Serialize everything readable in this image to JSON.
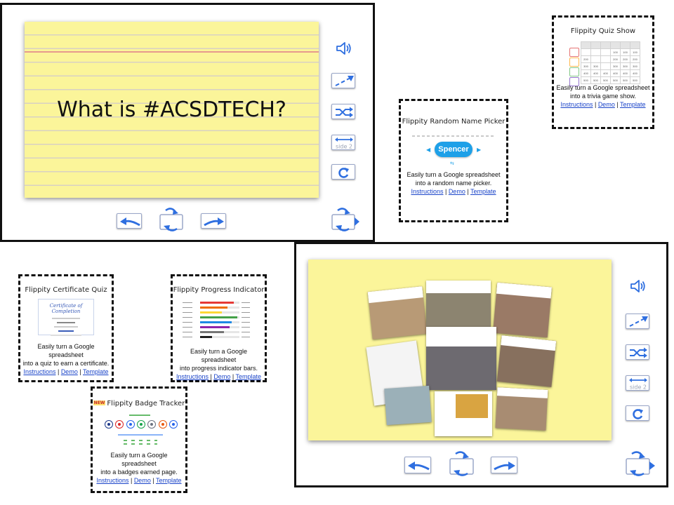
{
  "main_slide": {
    "card_text": "What is #ACSDTECH?"
  },
  "random_picker": {
    "title": "Flippity Random Name Picker",
    "selected_name": "Spencer",
    "desc_line1": "Easily turn a Google spreadsheet",
    "desc_line2": "into a random name picker.",
    "link_instructions": "Instructions",
    "link_demo": "Demo",
    "link_template": "Template",
    "sep": " | "
  },
  "quiz_show": {
    "title": "Flippity Quiz Show",
    "desc_line1": "Easily turn a Google spreadsheet",
    "desc_line2": "into a trivia game show.",
    "link_instructions": "Instructions",
    "link_demo": "Demo",
    "link_template": "Template",
    "sep": " | ",
    "rows": [
      [
        "",
        "",
        "",
        "100",
        "100",
        "100"
      ],
      [
        "200",
        "",
        "",
        "200",
        "200",
        "200"
      ],
      [
        "300",
        "300",
        "",
        "300",
        "300",
        "300"
      ],
      [
        "400",
        "400",
        "400",
        "400",
        "400",
        "400"
      ],
      [
        "500",
        "500",
        "500",
        "500",
        "500",
        "500"
      ]
    ]
  },
  "certificate_quiz": {
    "title": "Flippity Certificate Quiz",
    "cert_heading": "Certificate of Completion",
    "desc_line1": "Easily turn a Google spreadsheet",
    "desc_line2": "into a quiz to earn a certificate.",
    "link_instructions": "Instructions",
    "link_demo": "Demo",
    "link_template": "Template",
    "sep": " | "
  },
  "progress_indicator": {
    "title": "Flippity Progress Indicator",
    "desc_line1": "Easily turn a Google spreadsheet",
    "desc_line2": "into progress indicator bars.",
    "link_instructions": "Instructions",
    "link_demo": "Demo",
    "link_template": "Template",
    "sep": " | ",
    "bars": [
      {
        "fill": 0.85,
        "color": "#e53935"
      },
      {
        "fill": 0.7,
        "color": "#ef6c00"
      },
      {
        "fill": 0.55,
        "color": "#fdd835"
      },
      {
        "fill": 0.95,
        "color": "#43a047"
      },
      {
        "fill": 0.8,
        "color": "#1e88e5"
      },
      {
        "fill": 0.75,
        "color": "#8e24aa"
      },
      {
        "fill": 0.6,
        "color": "#757575"
      },
      {
        "fill": 0.3,
        "color": "#212121"
      }
    ]
  },
  "badge_tracker": {
    "new_badge": "NEW",
    "title": "Flippity Badge Tracker",
    "desc_line1": "Easily turn a Google spreadsheet",
    "desc_line2": "into a badges earned page.",
    "link_instructions": "Instructions",
    "link_demo": "Demo",
    "link_template": "Template",
    "sep": " | ",
    "badge_colors": [
      "#1e3a8a",
      "#dc2626",
      "#2563eb",
      "#16a34a",
      "#6b7280",
      "#ea580c",
      "#2563eb"
    ]
  },
  "colors": {
    "card_yellow": "#fbf59a",
    "button_blue": "#2f6fe0",
    "link_blue": "#1a44c9",
    "picker_blue": "#1ea0e8"
  },
  "icons": [
    "speaker-icon",
    "shuffle-icon",
    "flip-icon",
    "reload-icon",
    "arrow-left-icon",
    "arrow-right-icon",
    "next-icon"
  ]
}
